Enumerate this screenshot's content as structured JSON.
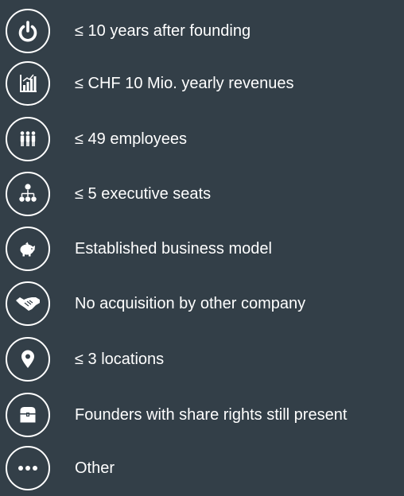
{
  "criteria": [
    {
      "icon": "power-icon",
      "label": "≤ 10 years after founding"
    },
    {
      "icon": "bar-chart-icon",
      "label": "≤ CHF 10 Mio. yearly revenues"
    },
    {
      "icon": "people-icon",
      "label": "≤ 49 employees"
    },
    {
      "icon": "org-chart-icon",
      "label": "≤ 5 executive seats"
    },
    {
      "icon": "piggy-bank-icon",
      "label": "Established business model"
    },
    {
      "icon": "handshake-icon",
      "label": "No acquisition by other company"
    },
    {
      "icon": "location-pin-icon",
      "label": "≤ 3 locations"
    },
    {
      "icon": "treasure-chest-icon",
      "label": "Founders with share rights still present"
    },
    {
      "icon": "more-dots-icon",
      "label": "Other"
    }
  ],
  "colors": {
    "background": "#333f48",
    "foreground": "#ffffff"
  }
}
